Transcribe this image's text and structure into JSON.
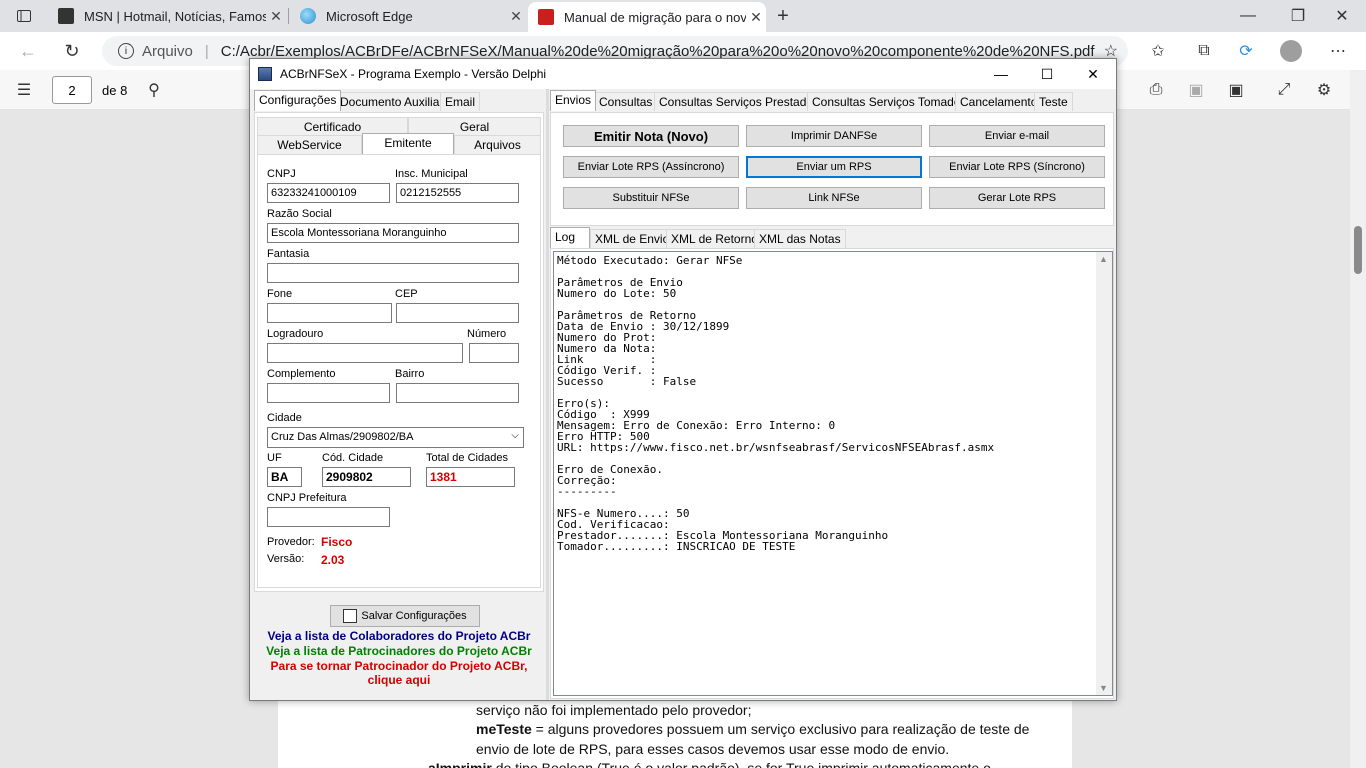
{
  "browser": {
    "tabs": [
      {
        "title": "MSN | Hotmail, Notícias, Famosos, Esportes e mais"
      },
      {
        "title": "Microsoft Edge"
      },
      {
        "title": "Manual de migração para o novo componente de NFS"
      }
    ],
    "address": {
      "site_label": "Arquivo",
      "url": "C:/Acbr/Exemplos/ACBrDFe/ACBrNFSeX/Manual%20de%20migração%20para%20o%20novo%20componente%20de%20NFS.pdf"
    },
    "pdf_toolbar": {
      "page": "2",
      "page_total": "de 8"
    }
  },
  "document": {
    "lines": [
      "serviço não foi implementado pelo provedor;",
      "envio de lote de RPS, para esses casos devemos usar esse modo de envio."
    ],
    "meteste_term": "meTeste",
    "meteste_text": " = alguns provedores possuem um serviço exclusivo para realização de teste de",
    "last_line_term": "aImprimir",
    "last_line_text": " do tipo Boolean (True é o valor padrão), se for True imprimir automaticamente o"
  },
  "app": {
    "title": "ACBrNFSeX - Programa Exemplo - Versão Delphi",
    "left_tabs": [
      "Configurações",
      "Documento Auxiliar",
      "Email"
    ],
    "sub_tabs_row1": [
      "Certificado",
      "Geral"
    ],
    "sub_tabs_row2": [
      "WebService",
      "Emitente",
      "Arquivos"
    ],
    "form": {
      "cnpj_label": "CNPJ",
      "cnpj": "63233241000109",
      "im_label": "Insc. Municipal",
      "im": "0212152555",
      "razao_label": "Razão Social",
      "razao": "Escola Montessoriana Moranguinho",
      "fantasia_label": "Fantasia",
      "fantasia": "",
      "fone_label": "Fone",
      "fone": "",
      "cep_label": "CEP",
      "cep": "",
      "logradouro_label": "Logradouro",
      "logradouro": "",
      "numero_label": "Número",
      "numero": "",
      "complemento_label": "Complemento",
      "complemento": "",
      "bairro_label": "Bairro",
      "bairro": "",
      "cidade_label": "Cidade",
      "cidade": "Cruz Das Almas/2909802/BA",
      "uf_label": "UF",
      "uf": "BA",
      "codcidade_label": "Cód. Cidade",
      "codcidade": "2909802",
      "totalcidades_label": "Total de Cidades",
      "totalcidades": "1381",
      "cnpjpref_label": "CNPJ Prefeitura",
      "cnpjpref": "",
      "provedor_label": "Provedor:",
      "provedor": "Fisco",
      "versao_label": "Versão:",
      "versao": "2.03"
    },
    "save_button": "Salvar Configurações",
    "links": {
      "colaboradores": "Veja a lista de Colaboradores do Projeto ACBr",
      "patrocinadores": "Veja a lista de Patrocinadores do Projeto ACBr",
      "patrocinador_1": "Para se tornar Patrocinador do Projeto ACBr,",
      "patrocinador_2": "clique aqui"
    },
    "right_tabs": [
      "Envios",
      "Consultas",
      "Consultas Serviços Prestados",
      "Consultas Serviços Tomados",
      "Cancelamento",
      "Teste"
    ],
    "buttons": {
      "emitir": "Emitir Nota (Novo)",
      "imprimir": "Imprimir DANFSe",
      "email": "Enviar e-mail",
      "lote_assinc": "Enviar Lote RPS (Assíncrono)",
      "enviar_rps": "Enviar um RPS",
      "lote_sinc": "Enviar Lote RPS (Síncrono)",
      "substituir": "Substituir NFSe",
      "link": "Link NFSe",
      "gerar_lote": "Gerar Lote RPS"
    },
    "log_tabs": [
      "Log",
      "XML de Envio",
      "XML de Retorno",
      "XML das Notas"
    ],
    "log_text": "Método Executado: Gerar NFSe\n\nParâmetros de Envio\nNumero do Lote: 50\n\nParâmetros de Retorno\nData de Envio : 30/12/1899\nNumero do Prot:\nNumero da Nota:\nLink          :\nCódigo Verif. :\nSucesso       : False\n\nErro(s):\nCódigo  : X999\nMensagem: Erro de Conexão: Erro Interno: 0\nErro HTTP: 500\nURL: https://www.fisco.net.br/wsnfseabrasf/ServicosNFSEAbrasf.asmx\n\nErro de Conexão.\nCorreção:\n---------\n\nNFS-e Numero....: 50\nCod. Verificacao:\nPrestador.......: Escola Montessoriana Moranguinho\nTomador.........: INSCRICAO DE TESTE",
    "colors": {
      "accent": "#0078d7",
      "red": "#d40000",
      "navy": "#000080",
      "green": "#008000"
    }
  }
}
